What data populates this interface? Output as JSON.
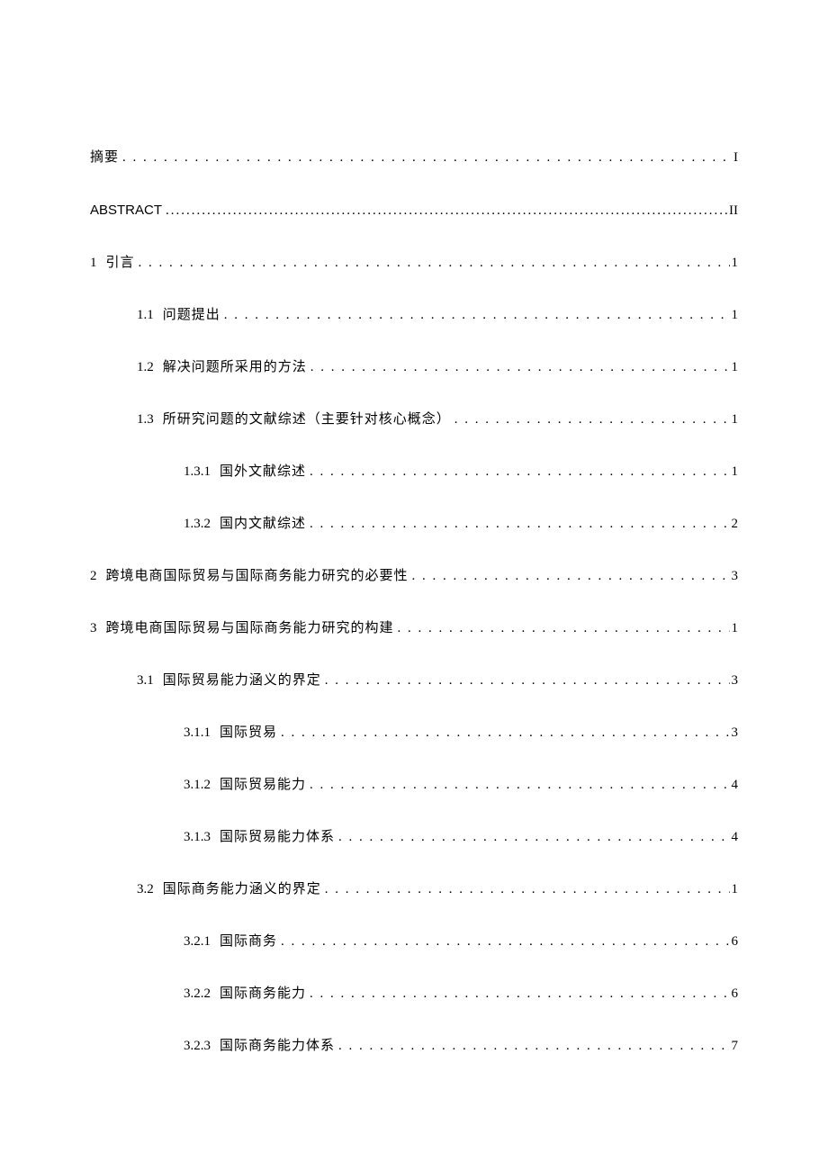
{
  "toc": [
    {
      "level": 0,
      "num": "",
      "title": "摘要",
      "page": "I",
      "dots": "normal"
    },
    {
      "level": 0,
      "num": "",
      "title": "ABSTRACT",
      "page": "II",
      "dots": "tight",
      "en": true
    },
    {
      "level": 0,
      "num": "1",
      "title": "引言",
      "page": "1",
      "dots": "normal"
    },
    {
      "level": 1,
      "num": "1.1",
      "title": "问题提出",
      "page": "1",
      "dots": "normal"
    },
    {
      "level": 1,
      "num": "1.2",
      "title": "解决问题所采用的方法",
      "page": "1",
      "dots": "normal"
    },
    {
      "level": 1,
      "num": "1.3",
      "title": "所研究问题的文献综述（主要针对核心概念）",
      "page": "1",
      "dots": "normal"
    },
    {
      "level": 2,
      "num": "1.3.1",
      "title": "国外文献综述",
      "page": "1",
      "dots": "normal"
    },
    {
      "level": 2,
      "num": "1.3.2",
      "title": "国内文献综述",
      "page": "2",
      "dots": "normal"
    },
    {
      "level": 0,
      "num": "2",
      "title": "跨境电商国际贸易与国际商务能力研究的必要性",
      "page": "3",
      "dots": "normal"
    },
    {
      "level": 0,
      "num": "3",
      "title": "跨境电商国际贸易与国际商务能力研究的构建",
      "page": "1",
      "dots": "normal"
    },
    {
      "level": 1,
      "num": "3.1",
      "title": "国际贸易能力涵义的界定",
      "page": "3",
      "dots": "normal"
    },
    {
      "level": 2,
      "num": "3.1.1",
      "title": "国际贸易",
      "page": "3",
      "dots": "normal"
    },
    {
      "level": 2,
      "num": "3.1.2",
      "title": "国际贸易能力",
      "page": "4",
      "dots": "normal"
    },
    {
      "level": 2,
      "num": "3.1.3",
      "title": "国际贸易能力体系",
      "page": "4",
      "dots": "normal"
    },
    {
      "level": 1,
      "num": "3.2",
      "title": "国际商务能力涵义的界定",
      "page": "1",
      "dots": "normal"
    },
    {
      "level": 2,
      "num": "3.2.1",
      "title": "国际商务",
      "page": "6",
      "dots": "normal"
    },
    {
      "level": 2,
      "num": "3.2.2",
      "title": "国际商务能力",
      "page": "6",
      "dots": "normal"
    },
    {
      "level": 2,
      "num": "3.2.3",
      "title": "国际商务能力体系",
      "page": "7",
      "dots": "normal"
    }
  ]
}
